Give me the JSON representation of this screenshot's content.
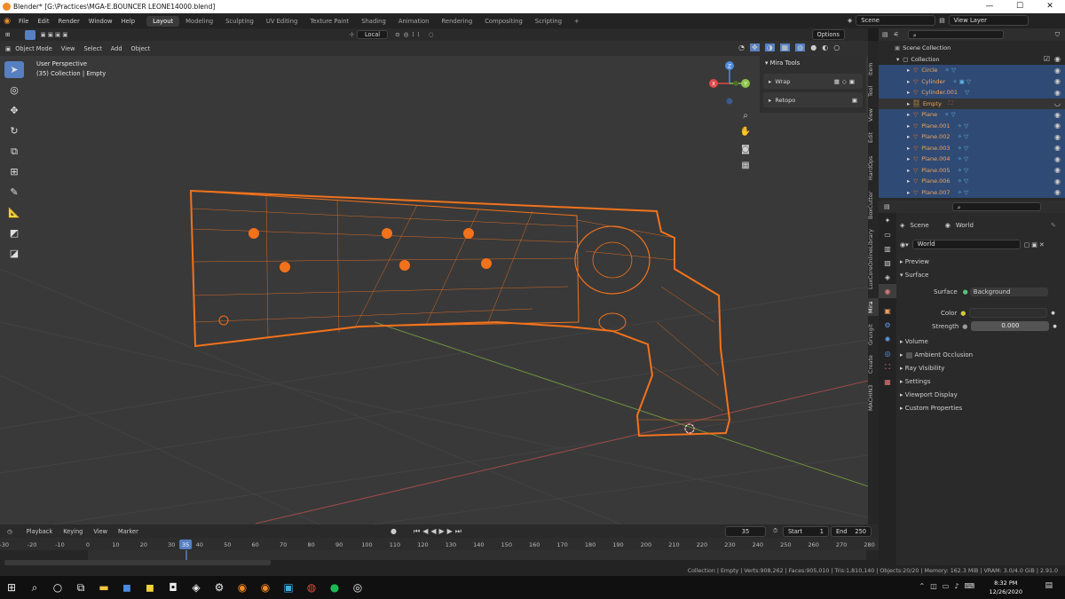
{
  "window": {
    "title": "Blender* [G:\\Practices\\MGA-E.BOUNCER LEONE14000.blend]"
  },
  "menu": {
    "items": [
      "File",
      "Edit",
      "Render",
      "Window",
      "Help"
    ]
  },
  "workspaces": [
    "Layout",
    "Modeling",
    "Sculpting",
    "UV Editing",
    "Texture Paint",
    "Shading",
    "Animation",
    "Rendering",
    "Compositing",
    "Scripting"
  ],
  "topright": {
    "scene": "Scene",
    "view_layer": "View Layer"
  },
  "viewport_header": {
    "pivot": "Local",
    "options": "Options"
  },
  "tool_header": {
    "mode": "Object Mode",
    "menus": [
      "View",
      "Select",
      "Add",
      "Object"
    ]
  },
  "viewport": {
    "perspective": "User Perspective",
    "collection": "(35) Collection | Empty"
  },
  "gizmo": {
    "x": "X",
    "y": "Y",
    "z": "Z"
  },
  "mira": {
    "title": "Mira Tools",
    "items": [
      "Wrap",
      "Retopo"
    ]
  },
  "side_tabs": [
    "Item",
    "Tool",
    "View",
    "Edit",
    "HardOps",
    "BoxCutter",
    "LuxCoreOnlineLibrary",
    "Mira",
    "Grungit",
    "Create",
    "MACHIN3"
  ],
  "outliner": {
    "scene_collection": "Scene Collection",
    "collection": "Collection",
    "items": [
      "Circle",
      "Cylinder",
      "Cylinder.001",
      "Empty",
      "Plane",
      "Plane.001",
      "Plane.002",
      "Plane.003",
      "Plane.004",
      "Plane.005",
      "Plane.006",
      "Plane.007"
    ]
  },
  "properties": {
    "breadcrumb_scene": "Scene",
    "breadcrumb_world": "World",
    "world_name": "World",
    "preview": "Preview",
    "surface": "Surface",
    "surface_label": "Surface",
    "surface_value": "Background",
    "color_label": "Color",
    "strength_label": "Strength",
    "strength_value": "0.000",
    "volume": "Volume",
    "ambient_occlusion": "Ambient Occlusion",
    "ray_visibility": "Ray Visibility",
    "settings": "Settings",
    "viewport_display": "Viewport Display",
    "custom_properties": "Custom Properties"
  },
  "timeline": {
    "menus": [
      "Playback",
      "Keying",
      "View",
      "Marker"
    ],
    "current_frame": "35",
    "start_label": "Start",
    "start": "1",
    "end_label": "End",
    "end": "250",
    "ticks": [
      "-30",
      "-20",
      "-10",
      "0",
      "10",
      "20",
      "30",
      "35",
      "40",
      "50",
      "60",
      "70",
      "80",
      "90",
      "100",
      "110",
      "120",
      "130",
      "140",
      "150",
      "160",
      "170",
      "180",
      "190",
      "200",
      "210",
      "220",
      "230",
      "240",
      "250",
      "260",
      "270",
      "280"
    ]
  },
  "status": {
    "text": "Collection | Empty | Verts:908,262 | Faces:905,010 | Tris:1,810,140 | Objects:20/20 | Memory: 162.3 MiB | VRAM: 3.0/4.0 GiB | 2.91.0"
  },
  "clock": {
    "time": "8:32 PM",
    "date": "12/26/2020"
  },
  "colors": {
    "selection": "#f2721c",
    "accent": "#5680c2",
    "viewport_bg": "#393939"
  }
}
